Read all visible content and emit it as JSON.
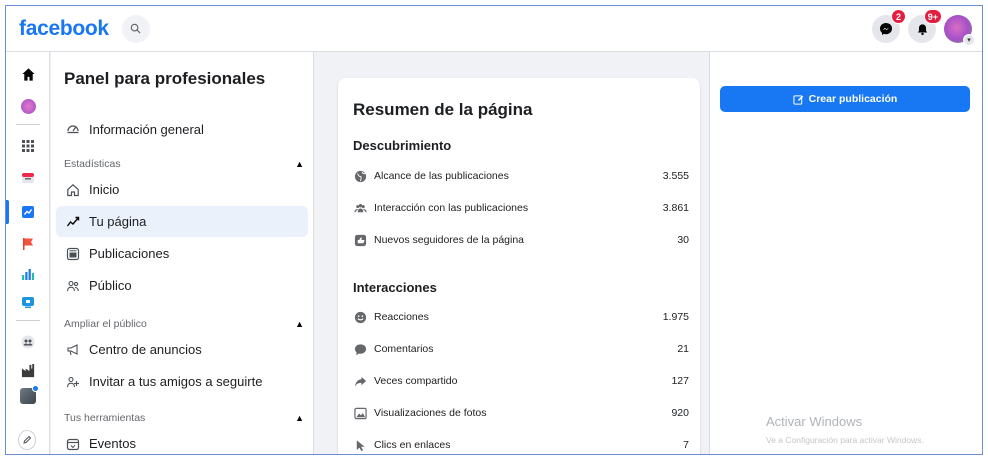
{
  "header": {
    "logo": "facebook",
    "messenger_badge": "2",
    "notifications_badge": "9+"
  },
  "colors": {
    "brand": "#1877f2",
    "badge": "#e41e3f",
    "active_bg": "#ebf1fb"
  },
  "rail": {
    "icons": [
      "home-icon",
      "profile-avatar",
      "apps-grid-icon",
      "inbox-icon",
      "dashboard-icon",
      "flag-icon",
      "insights-icon",
      "ads-icon",
      "groups-icon",
      "factory-icon",
      "settings-icon",
      "edit-icon"
    ]
  },
  "nav": {
    "title": "Panel para profesionales",
    "overview": "Información general",
    "sections": [
      {
        "label": "Estadísticas",
        "items": [
          "Inicio",
          "Tu página",
          "Publicaciones",
          "Público"
        ]
      },
      {
        "label": "Ampliar el público",
        "items": [
          "Centro de anuncios",
          "Invitar a tus amigos a seguirte"
        ]
      },
      {
        "label": "Tus herramientas",
        "items": [
          "Eventos"
        ]
      }
    ]
  },
  "summary": {
    "title": "Resumen de la página",
    "discovery": {
      "heading": "Descubrimiento",
      "rows": [
        {
          "label": "Alcance de las publicaciones",
          "value": "3.555"
        },
        {
          "label": "Interacción con las publicaciones",
          "value": "3.861"
        },
        {
          "label": "Nuevos seguidores de la página",
          "value": "30"
        }
      ]
    },
    "interactions": {
      "heading": "Interacciones",
      "rows": [
        {
          "label": "Reacciones",
          "value": "1.975"
        },
        {
          "label": "Comentarios",
          "value": "21"
        },
        {
          "label": "Veces compartido",
          "value": "127"
        },
        {
          "label": "Visualizaciones de fotos",
          "value": "920"
        },
        {
          "label": "Clics en enlaces",
          "value": "7"
        }
      ]
    }
  },
  "actions": {
    "create_post": "Crear publicación"
  },
  "watermark": {
    "title": "Activar Windows",
    "subtitle": "Ve a Configuración para activar Windows."
  }
}
